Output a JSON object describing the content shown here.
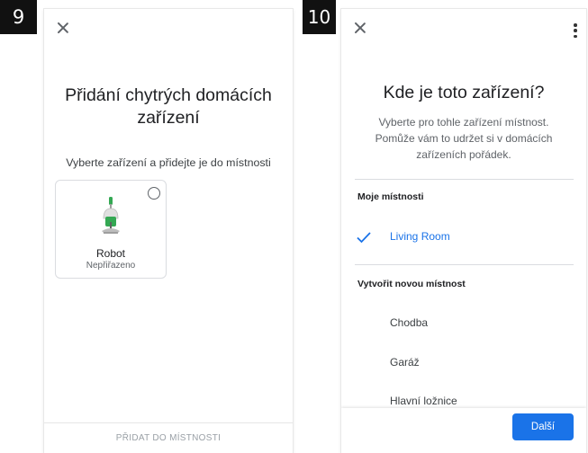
{
  "steps": {
    "left": "9",
    "right": "10"
  },
  "left_screen": {
    "close_icon": "close-icon",
    "title": "Přidání chytrých domácích zařízení",
    "subtitle": "Vyberte zařízení a přidejte je do místnosti",
    "device": {
      "name": "Robot",
      "status": "Nepřiřazeno",
      "icon": "robot-vacuum-icon",
      "selected": false
    },
    "footer_button": "PŘIDAT DO MÍSTNOSTI"
  },
  "right_screen": {
    "close_icon": "close-icon",
    "menu_icon": "more-vert-icon",
    "title": "Kde je toto zařízení?",
    "description": "Vyberte pro tohle zařízení místnost. Pomůže vám to udržet si v domácích zařízeních pořádek.",
    "my_rooms_label": "Moje místnosti",
    "my_rooms": [
      {
        "label": "Living Room",
        "selected": true
      }
    ],
    "new_room_label": "Vytvořit novou místnost",
    "new_rooms": [
      "Chodba",
      "Garáž",
      "Hlavní ložnice"
    ],
    "next_button": "Další"
  },
  "colors": {
    "accent": "#1a73e8",
    "device_icon_green": "#34a853",
    "text_primary": "#202124",
    "text_secondary": "#5f6368",
    "disabled": "#9aa0a6"
  }
}
